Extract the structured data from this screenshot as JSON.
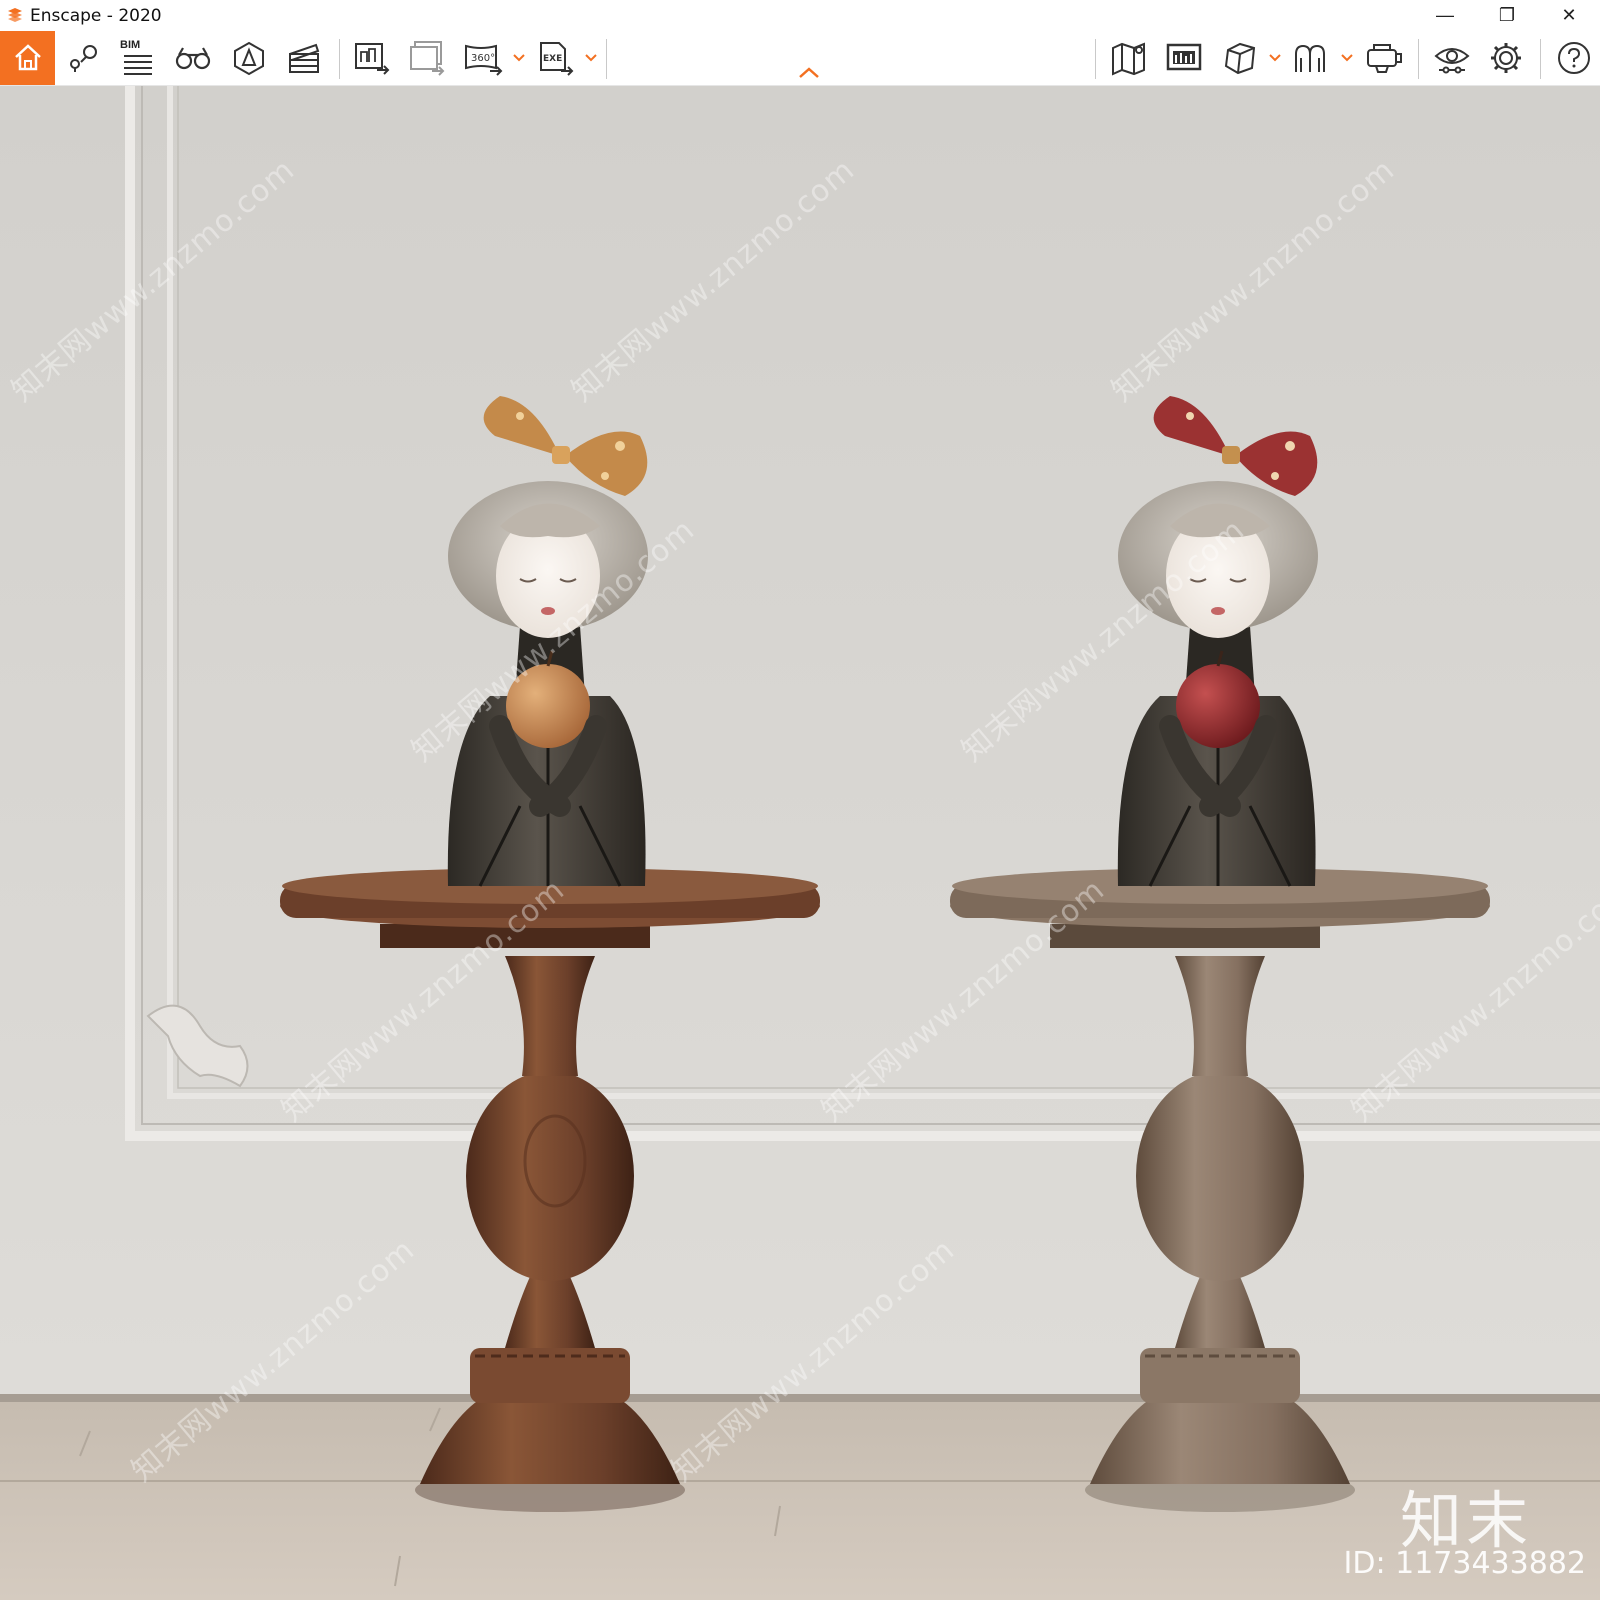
{
  "window": {
    "title": "Enscape - 2020",
    "controls": {
      "minimize": "—",
      "restore": "❐",
      "close": "✕"
    }
  },
  "toolbar": {
    "left_buttons": [
      {
        "name": "home",
        "icon": "home-icon"
      },
      {
        "name": "views",
        "icon": "map-pin-views-icon"
      },
      {
        "name": "bim",
        "icon": "bim-list-icon",
        "label": "BIM"
      },
      {
        "name": "walk-mode",
        "icon": "binoculars-icon"
      },
      {
        "name": "assets",
        "icon": "asset-library-icon"
      },
      {
        "name": "video-editor",
        "icon": "clapperboard-icon"
      },
      {
        "name": "render-image",
        "icon": "export-image-icon"
      },
      {
        "name": "batch-render",
        "icon": "batch-export-icon"
      },
      {
        "name": "panorama",
        "icon": "panorama-360-icon",
        "label": "360°"
      },
      {
        "name": "export-exe",
        "icon": "export-exe-icon",
        "label": "EXE"
      }
    ],
    "right_buttons": [
      {
        "name": "minimap",
        "icon": "map-icon"
      },
      {
        "name": "batch-view",
        "icon": "screen-icon"
      },
      {
        "name": "section",
        "icon": "cube-icon"
      },
      {
        "name": "collaborate",
        "icon": "people-icon"
      },
      {
        "name": "vr",
        "icon": "vr-headset-icon"
      },
      {
        "name": "visual-settings",
        "icon": "eye-icon"
      },
      {
        "name": "settings",
        "icon": "gear-icon"
      },
      {
        "name": "help",
        "icon": "question-icon"
      }
    ]
  },
  "watermark": {
    "text": "知末网www.znzmo.com",
    "logo": "知末",
    "id": "ID: 1173433882"
  },
  "colors": {
    "accent": "#f37021",
    "wall": "#dcdad6",
    "floor": "#cbc2b7",
    "wood_left": "#6b3f2a",
    "wood_right": "#8a7563",
    "bow_left": "#c48a4a",
    "bow_right": "#9b3232"
  }
}
